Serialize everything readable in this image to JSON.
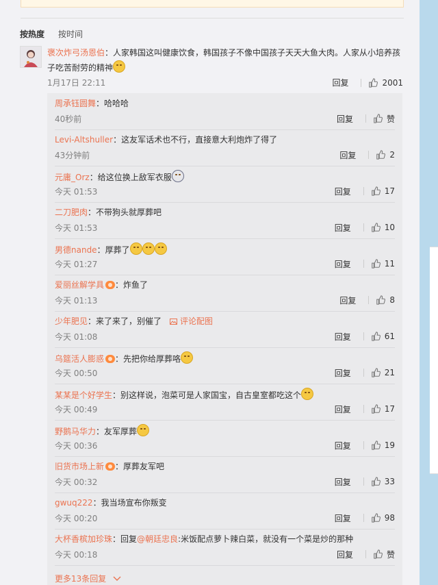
{
  "sort": {
    "active": "按热度",
    "other": "按时间"
  },
  "main_comment": {
    "user": "褒次炸弓汤恩伯",
    "text": "：人家韩国这叫健康饮食，韩国孩子不像中国孩子天天大鱼大肉。人家从小培养孩子吃苦耐劳的精神",
    "time": "1月17日 22:11",
    "reply_label": "回复",
    "likes": "2001"
  },
  "replies": [
    {
      "user": "周承钰圆舞",
      "vip": false,
      "text": "：哈哈哈",
      "emojis": 0,
      "time": "40秒前",
      "likes": "赞"
    },
    {
      "user": "Levi-Altshuller",
      "vip": false,
      "text": "：这友军话术也不行，直接意大利炮炸了得了",
      "emojis": 0,
      "time": "43分钟前",
      "likes": "2"
    },
    {
      "user": "元庸_Orz",
      "vip": false,
      "text": "：给这位换上敌军衣服",
      "emojis": 1,
      "emoji_dark": true,
      "time": "今天 01:53",
      "likes": "17"
    },
    {
      "user": "二刀肥肉",
      "vip": false,
      "text": "：不带狗头就厚葬吧",
      "emojis": 0,
      "time": "今天 01:53",
      "likes": "10"
    },
    {
      "user": "男德nande",
      "vip": false,
      "text": "：厚葬了",
      "emojis": 3,
      "time": "今天 01:27",
      "likes": "11"
    },
    {
      "user": "爱丽丝解学具",
      "vip": true,
      "text": "：炸鱼了",
      "emojis": 0,
      "time": "今天 01:13",
      "likes": "8"
    },
    {
      "user": "少年肥见",
      "vip": false,
      "text": "：来了来了，别催了",
      "emojis": 0,
      "pic_link": "评论配图",
      "time": "今天 01:08",
      "likes": "61"
    },
    {
      "user": "乌筵活人膨惑",
      "vip": true,
      "text": "：先把你给厚葬咯",
      "emojis": 1,
      "time": "今天 00:50",
      "likes": "21"
    },
    {
      "user": "某某是个好学生",
      "vip": false,
      "text": "：别这样说，泡菜可是人家国宝，自古皇室都吃这个",
      "emojis": 1,
      "time": "今天 00:49",
      "likes": "17"
    },
    {
      "user": "野鹅马华力",
      "vip": false,
      "text": "：友军厚葬",
      "emojis": 1,
      "time": "今天 00:36",
      "likes": "19"
    },
    {
      "user": "旧货市场上新",
      "vip": true,
      "text": "：厚葬友军吧",
      "emojis": 0,
      "time": "今天 00:32",
      "likes": "33"
    },
    {
      "user": "gwuq222",
      "vip": false,
      "text": "：我当场宣布你叛变",
      "emojis": 0,
      "time": "今天 00:20",
      "likes": "98"
    },
    {
      "user": "大杯香槟加珍珠",
      "vip": false,
      "text": "：回复",
      "mention": "@朝廷忠良",
      "text2": ":米饭配点萝卜辣白菜，就没有一个菜是炒的那种",
      "emojis": 0,
      "time": "今天 00:18",
      "likes": "赞"
    }
  ],
  "reply_label": "回复",
  "more_label": "更多13条回复",
  "colors": {
    "username": "#eb7350",
    "bg": "#f2f2f5"
  }
}
